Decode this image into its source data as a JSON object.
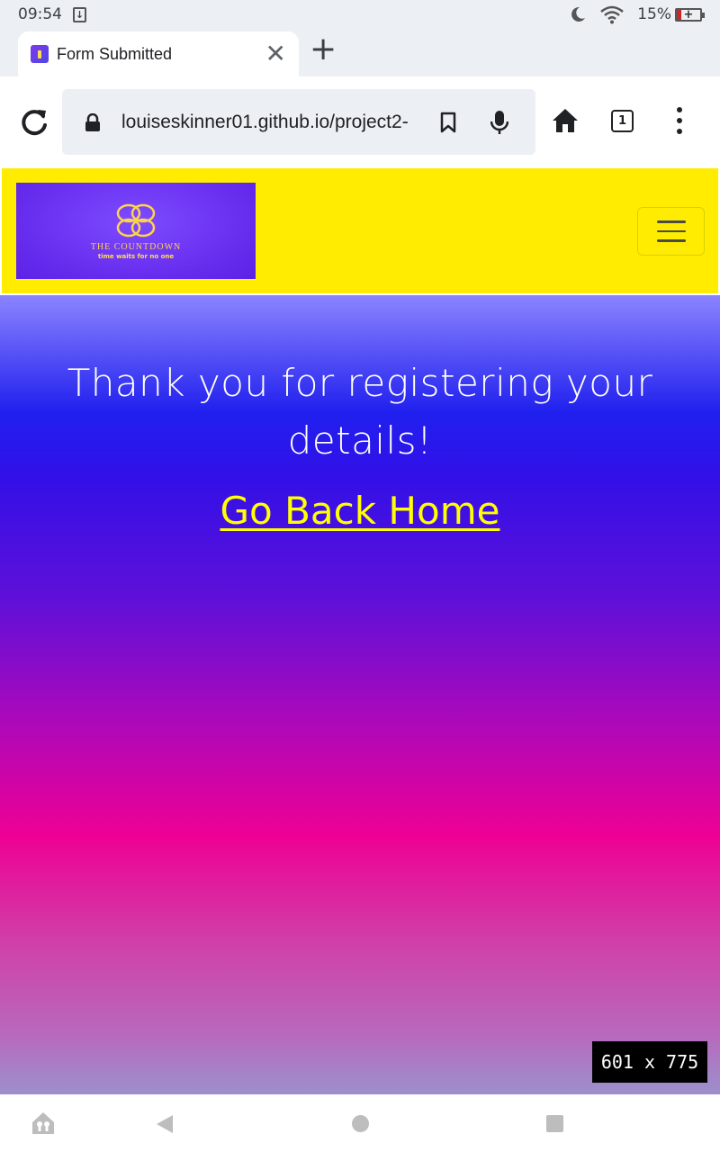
{
  "status_bar": {
    "time": "09:54",
    "download_glyph": "↓",
    "battery_percent": "15%",
    "icons": [
      "download-icon",
      "moon-icon",
      "wifi-icon",
      "battery-charging-icon"
    ]
  },
  "browser": {
    "tab_title": "Form Submitted",
    "tab_close": "✕",
    "new_tab": "+",
    "url": "louiseskinner01.github.io/project2-",
    "tab_count": "1"
  },
  "site": {
    "logo_name": "THE COUNTDOWN",
    "logo_tagline": "time waits for no one",
    "header_color": "#ffec00"
  },
  "main": {
    "heading": "Thank you for registering your details!",
    "home_link": "Go Back Home",
    "link_color": "#ffff00"
  },
  "overlay": {
    "dimensions": "601  x  775"
  }
}
